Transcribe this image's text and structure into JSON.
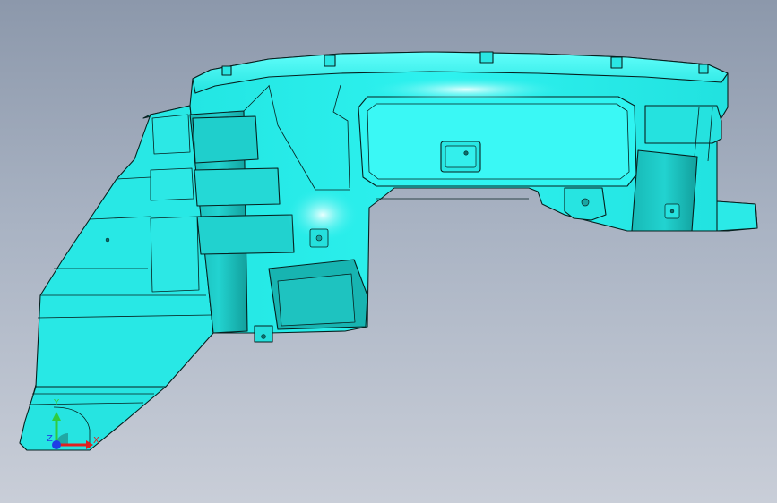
{
  "viewport": {
    "background_top": "#8c98ab",
    "background_bottom": "#c9ced8"
  },
  "model": {
    "fill_color": "#27ecea",
    "highlight_color": "#b8fffd",
    "shade_color": "#14b7b5",
    "edge_color": "#06201f"
  },
  "triad": {
    "x_label": "X",
    "y_label": "Y",
    "z_label": "Z",
    "x_color": "#e02020",
    "y_color": "#2ecc40",
    "z_color": "#1f3ee6"
  }
}
